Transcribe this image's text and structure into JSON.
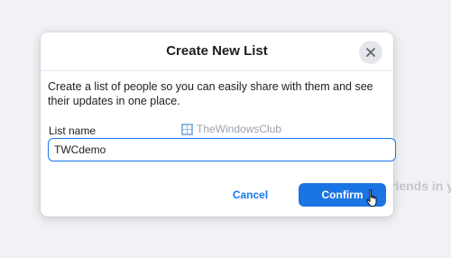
{
  "background": {
    "partial_text": "riends in y"
  },
  "dialog": {
    "title": "Create New List",
    "description": "Create a list of people so you can easily share with them and see their updates in one place.",
    "field_label": "List name",
    "field_value": "TWCdemo",
    "cancel_label": "Cancel",
    "confirm_label": "Confirm",
    "close_icon": "close-icon"
  },
  "watermark": {
    "text": "TheWindowsClub"
  },
  "colors": {
    "accent": "#1b74e4",
    "link": "#1877f2",
    "background": "#f0f2f5",
    "close_button_bg": "#e4e6eb"
  }
}
